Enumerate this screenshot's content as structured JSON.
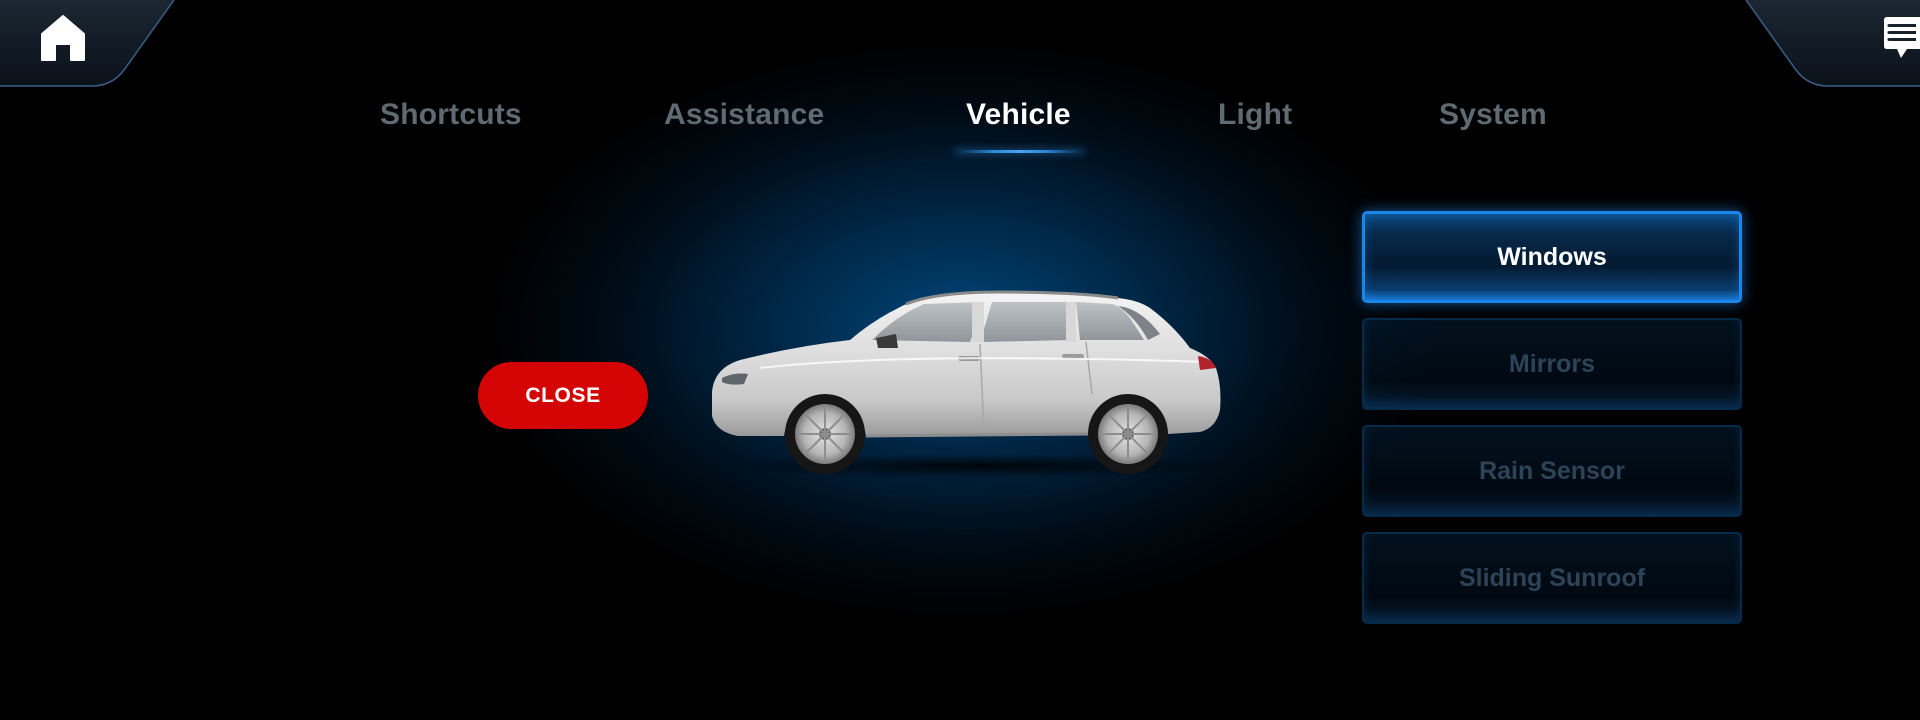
{
  "header": {
    "home_icon": "home-icon",
    "messages_icon": "message-icon"
  },
  "tabs": [
    {
      "label": "Shortcuts",
      "active": false
    },
    {
      "label": "Assistance",
      "active": false
    },
    {
      "label": "Vehicle",
      "active": true
    },
    {
      "label": "Light",
      "active": false
    },
    {
      "label": "System",
      "active": false
    }
  ],
  "close_button": {
    "label": "CLOSE",
    "color": "#d40404"
  },
  "vehicle_options": [
    {
      "label": "Windows",
      "selected": true
    },
    {
      "label": "Mirrors",
      "selected": false
    },
    {
      "label": "Rain Sensor",
      "selected": false
    },
    {
      "label": "Sliding Sunroof",
      "selected": false
    }
  ],
  "colors": {
    "accent": "#1a86ea",
    "background": "#000000",
    "active_text": "#ffffff",
    "inactive_text": "#5f6a73"
  }
}
